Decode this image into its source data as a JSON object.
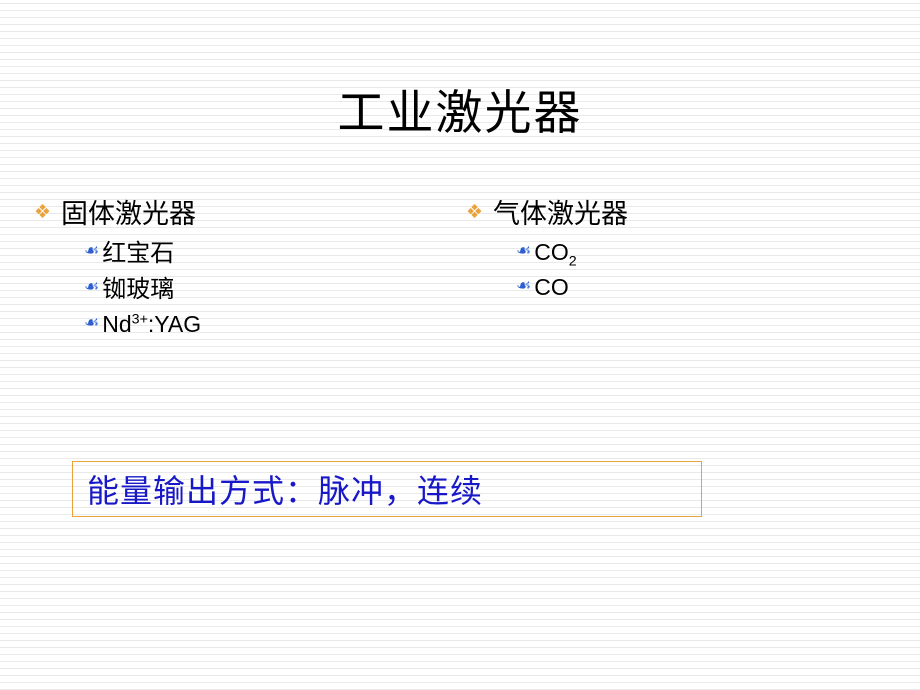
{
  "slide": {
    "title": "工业激光器",
    "columns": [
      {
        "name": "solid-state-lasers",
        "heading": "固体激光器",
        "bullet_level1": "❖",
        "bullet_level2": "☙",
        "items": [
          {
            "text": "红宝石",
            "latin": false
          },
          {
            "text": "铷玻璃",
            "latin": false
          },
          {
            "text": "Nd3+:YAG",
            "latin": true,
            "parts": [
              {
                "t": "Nd"
              },
              {
                "t": "3+",
                "style": "sup"
              },
              {
                "t": ":YAG"
              }
            ]
          }
        ]
      },
      {
        "name": "gas-lasers",
        "heading": "气体激光器",
        "bullet_level1": "❖",
        "bullet_level2": "☙",
        "items": [
          {
            "text": "CO2",
            "latin": true,
            "parts": [
              {
                "t": "CO"
              },
              {
                "t": "2",
                "style": "sub"
              }
            ]
          },
          {
            "text": "CO",
            "latin": true,
            "parts": [
              {
                "t": "CO"
              }
            ]
          }
        ]
      }
    ],
    "callout": {
      "text": "能量输出方式：脉冲，连续",
      "border_color": "#E8A33D",
      "text_color": "#1818C8"
    },
    "colors": {
      "bullet_level1": "#E8A33D",
      "bullet_level2": "#2E5FD0",
      "title": "#000000",
      "background": "#ffffff",
      "stripe": "#e9e9e9"
    }
  }
}
